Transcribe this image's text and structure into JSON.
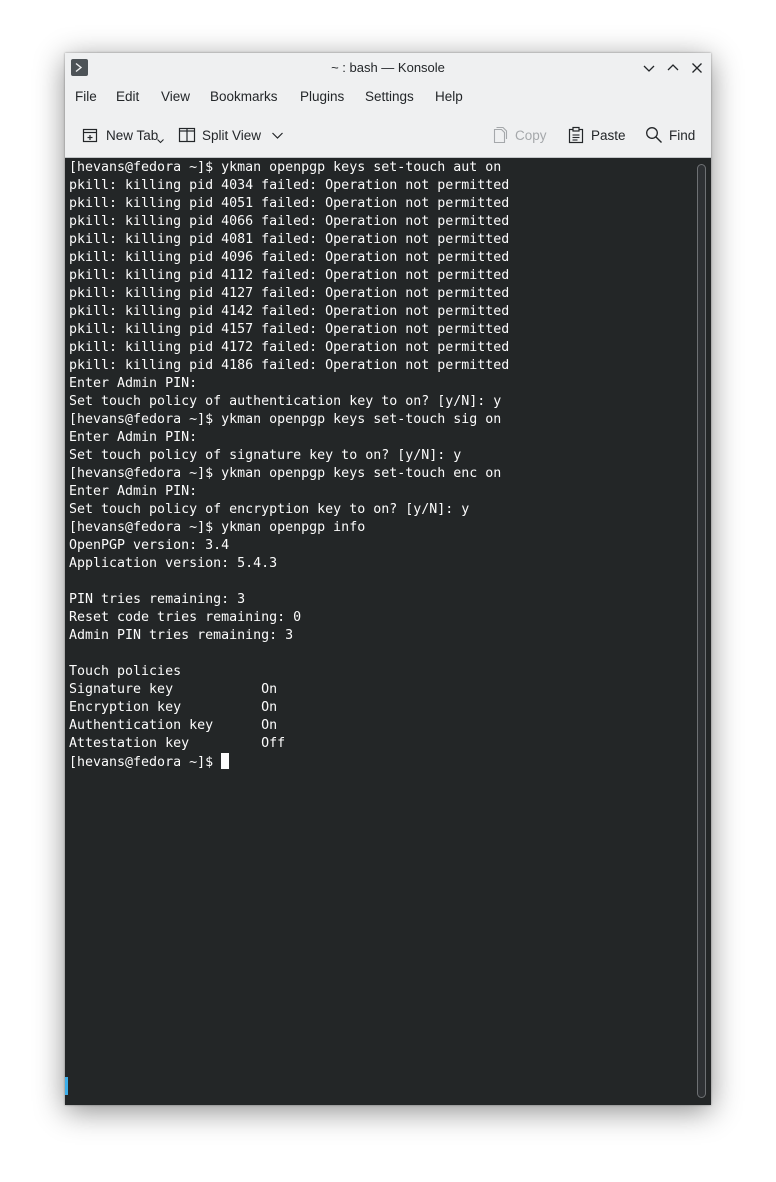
{
  "window": {
    "title": "~ : bash — Konsole",
    "icons": {
      "app": "terminal-app-icon",
      "minimize": "chevron-down-icon",
      "maximize": "chevron-up-icon",
      "close": "close-icon"
    }
  },
  "menubar": {
    "items": [
      "File",
      "Edit",
      "View",
      "Bookmarks",
      "Plugins",
      "Settings",
      "Help"
    ]
  },
  "toolbar": {
    "new_tab": "New Tab",
    "split_view": "Split View",
    "copy": "Copy",
    "paste": "Paste",
    "find": "Find"
  },
  "terminal": {
    "lines": [
      "[hevans@fedora ~]$ ykman openpgp keys set-touch aut on",
      "pkill: killing pid 4034 failed: Operation not permitted",
      "pkill: killing pid 4051 failed: Operation not permitted",
      "pkill: killing pid 4066 failed: Operation not permitted",
      "pkill: killing pid 4081 failed: Operation not permitted",
      "pkill: killing pid 4096 failed: Operation not permitted",
      "pkill: killing pid 4112 failed: Operation not permitted",
      "pkill: killing pid 4127 failed: Operation not permitted",
      "pkill: killing pid 4142 failed: Operation not permitted",
      "pkill: killing pid 4157 failed: Operation not permitted",
      "pkill: killing pid 4172 failed: Operation not permitted",
      "pkill: killing pid 4186 failed: Operation not permitted",
      "Enter Admin PIN:",
      "Set touch policy of authentication key to on? [y/N]: y",
      "[hevans@fedora ~]$ ykman openpgp keys set-touch sig on",
      "Enter Admin PIN:",
      "Set touch policy of signature key to on? [y/N]: y",
      "[hevans@fedora ~]$ ykman openpgp keys set-touch enc on",
      "Enter Admin PIN:",
      "Set touch policy of encryption key to on? [y/N]: y",
      "[hevans@fedora ~]$ ykman openpgp info",
      "OpenPGP version: 3.4",
      "Application version: 5.4.3",
      "",
      "PIN tries remaining: 3",
      "Reset code tries remaining: 0",
      "Admin PIN tries remaining: 3",
      "",
      "Touch policies",
      "Signature key           On",
      "Encryption key          On",
      "Authentication key      On",
      "Attestation key         Off"
    ],
    "prompt": "[hevans@fedora ~]$ "
  }
}
